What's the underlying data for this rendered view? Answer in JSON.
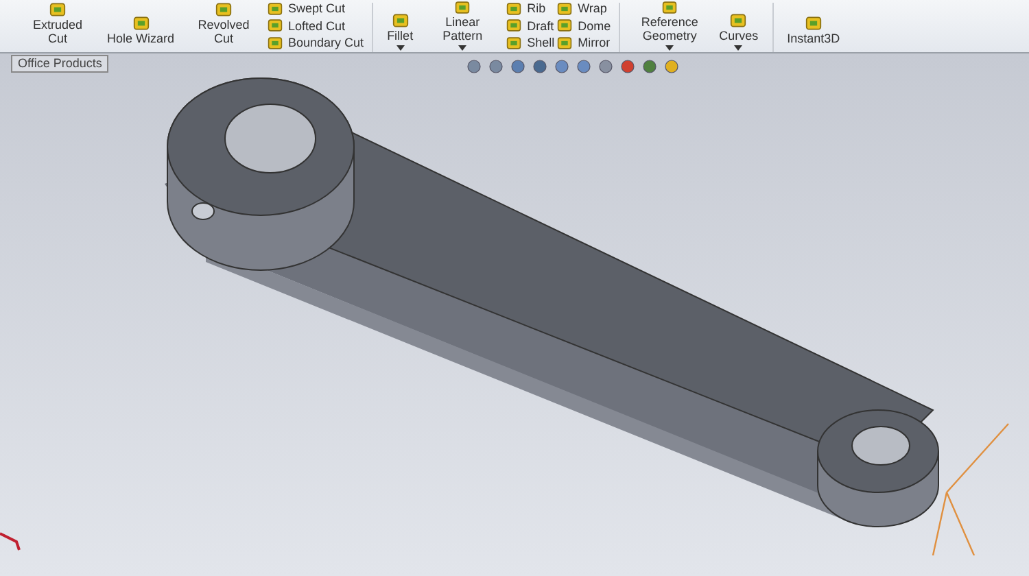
{
  "ribbon": {
    "groups": [
      {
        "kind": "large",
        "label": "Extruded Cut",
        "has_menu": false
      },
      {
        "kind": "large",
        "label": "Hole Wizard",
        "has_menu": false
      },
      {
        "kind": "large",
        "label": "Revolved Cut",
        "has_menu": false
      },
      {
        "kind": "stack",
        "items": [
          "Swept Cut",
          "Lofted Cut",
          "Boundary Cut"
        ]
      },
      {
        "kind": "separator"
      },
      {
        "kind": "large",
        "label": "Fillet",
        "has_menu": true
      },
      {
        "kind": "large",
        "label": "Linear Pattern",
        "has_menu": true
      },
      {
        "kind": "stack",
        "items": [
          "Rib",
          "Draft",
          "Shell"
        ]
      },
      {
        "kind": "stack",
        "items": [
          "Wrap",
          "Dome",
          "Mirror"
        ]
      },
      {
        "kind": "separator"
      },
      {
        "kind": "large",
        "label": "Reference Geometry",
        "has_menu": true
      },
      {
        "kind": "large",
        "label": "Curves",
        "has_menu": true
      },
      {
        "kind": "separator"
      },
      {
        "kind": "large",
        "label": "Instant3D",
        "has_menu": false
      }
    ]
  },
  "tabs": [
    {
      "label": "Office Products",
      "selected": true
    }
  ]
}
